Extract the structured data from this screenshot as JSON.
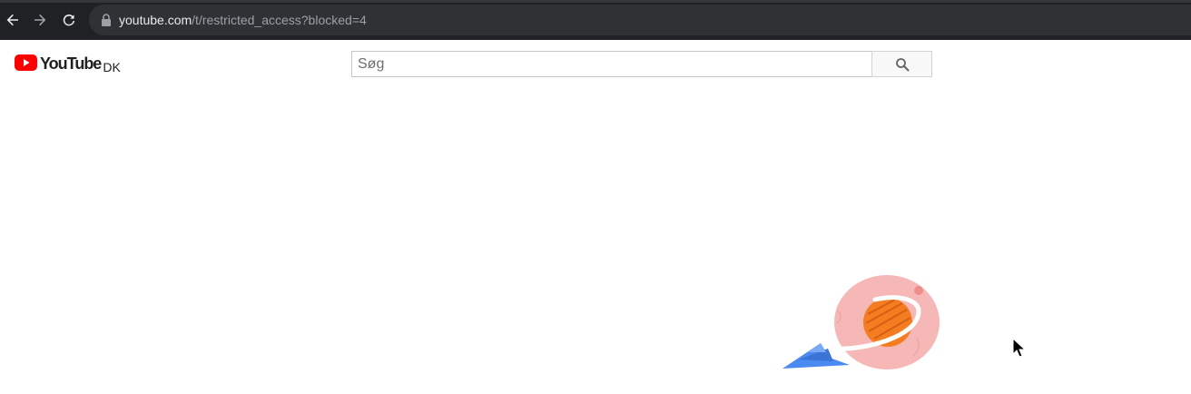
{
  "browser": {
    "url_host": "youtube.com",
    "url_path": "/t/restricted_access?blocked=4",
    "icons": {
      "back": "arrow-left-icon",
      "forward": "arrow-right-icon",
      "reload": "reload-icon",
      "lock": "lock-icon"
    }
  },
  "header": {
    "logo_text": "YouTube",
    "country_code": "DK",
    "logo_color": "#ff0000"
  },
  "search": {
    "placeholder": "Søg",
    "value": "",
    "button_icon": "search-icon"
  },
  "illustration": {
    "name": "planet-with-paper-plane",
    "colors": {
      "planet_halo": "#f6b8b6",
      "planet_core": "#f47d22",
      "paper_plane": "#4b8af2"
    }
  }
}
